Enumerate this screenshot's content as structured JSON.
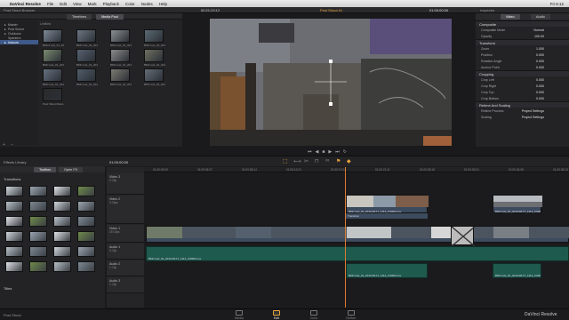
{
  "menubar": {
    "app": "DaVinci Resolve",
    "items": [
      "File",
      "Edit",
      "View",
      "Mark",
      "Playback",
      "Color",
      "Nodes",
      "Help"
    ],
    "right": "Fri 6:12"
  },
  "topbar": {
    "browser_title": "Post Shoot Browser",
    "timecode": "00:21:23:12",
    "clip_name": "Post Shoot #1",
    "viewer_timecode": "01:00:00:00",
    "inspector_title": "Inspector"
  },
  "media_pool": {
    "tabs": [
      "Timelines",
      "Media Pool"
    ],
    "bins": [
      "Master",
      "Post Scene",
      "Outdoors",
      "Sparkers",
      "Indoors"
    ],
    "column_header": "Untitled",
    "clips": [
      {
        "name": "BMC1 test_01_2013-08-17_1114_C0001.mov"
      },
      {
        "name": "BMC test_01_2013-08-17_1114_C0002.mov"
      },
      {
        "name": "BMC test_01_2013-08-17_1114_C0003.mov"
      },
      {
        "name": "BMC test_01_2013-08-17_1114_C0004.mov"
      },
      {
        "name": "BMC test_01_2013-08-17_1114_C0005.mov"
      },
      {
        "name": "BMC test_01_2013-08-17_1114_C0006.mov"
      },
      {
        "name": "BMC test_01_2013-08-17_1114_C0007.mov"
      },
      {
        "name": "BMC test_01_2013-08-17_1114_C0008.mov"
      },
      {
        "name": "BMC test_01_2013-08-17_1114_C0009.mov"
      },
      {
        "name": "BMC test_01_2013-08-17_1114_C0010.mov"
      },
      {
        "name": "BMC test_01_2013-08-17_1114_C0011.mov"
      },
      {
        "name": "BMC test_01_2013-08-17_1114_C0012.mov"
      },
      {
        "name": "Post Shoot Music.wav"
      }
    ]
  },
  "inspector": {
    "tabs": [
      "Video",
      "Audio"
    ],
    "sections": [
      {
        "title": "Composite",
        "rows": [
          {
            "label": "Composite Mode",
            "value": "Normal"
          },
          {
            "label": "Opacity",
            "value": "100.00"
          }
        ]
      },
      {
        "title": "Transform",
        "rows": [
          {
            "label": "Zoom",
            "value": "1.000"
          },
          {
            "label": "Position",
            "value": "0.000"
          },
          {
            "label": "Rotation Angle",
            "value": "0.000"
          },
          {
            "label": "Anchor Point",
            "value": "0.000"
          }
        ]
      },
      {
        "title": "Cropping",
        "rows": [
          {
            "label": "Crop Left",
            "value": "0.000"
          },
          {
            "label": "Crop Right",
            "value": "0.000"
          },
          {
            "label": "Crop Top",
            "value": "0.000"
          },
          {
            "label": "Crop Bottom",
            "value": "0.000"
          }
        ]
      },
      {
        "title": "Retime And Scaling",
        "rows": [
          {
            "label": "Retime Process",
            "value": "Project Settings"
          },
          {
            "label": "Scaling",
            "value": "Project Settings"
          }
        ]
      }
    ]
  },
  "effects_library": {
    "title": "Effects Library",
    "tabs": [
      "Toolbox",
      "Open FX"
    ],
    "section": "Transitions",
    "section2": "Titles"
  },
  "timeline": {
    "name": "Post Shoot #1",
    "timecode": "01:00:00:00",
    "ruler": [
      "01:00:00:00",
      "01:00:04:07",
      "01:00:08:14",
      "01:00:12:21",
      "01:00:17:04",
      "01:00:21:11",
      "01:00:25:18",
      "01:00:30:01",
      "01:00:34:08",
      "01:00:38:15"
    ],
    "tracks": [
      {
        "name": "Video 3",
        "sub": "0 Clip"
      },
      {
        "name": "Video 2",
        "sub": "3 Clips"
      },
      {
        "name": "Video 1",
        "sub": "15 Clips"
      },
      {
        "name": "Audio 1",
        "sub": "0 Clip"
      },
      {
        "name": "Audio 2",
        "sub": "1 Clip"
      },
      {
        "name": "Audio 3",
        "sub": "1 Clip"
      }
    ],
    "clip_label_v": "BMC test_01_2013-08-17_1114_C0008.mov",
    "transition_label": "Transition",
    "clip_label_a": "BMC test_01_2013-08-17_1114_C0008.mov"
  },
  "pages": [
    "Media",
    "Edit",
    "Color",
    "Deliver"
  ],
  "active_page": "Edit",
  "bottom": {
    "left": "Post Shoot",
    "brand": "DaVinci Resolve"
  },
  "colors": {
    "accent": "#e8a33a",
    "audio_clip": "#1f5a4e",
    "video_clip": "#3c4b5d",
    "playhead": "#e07b2e"
  }
}
